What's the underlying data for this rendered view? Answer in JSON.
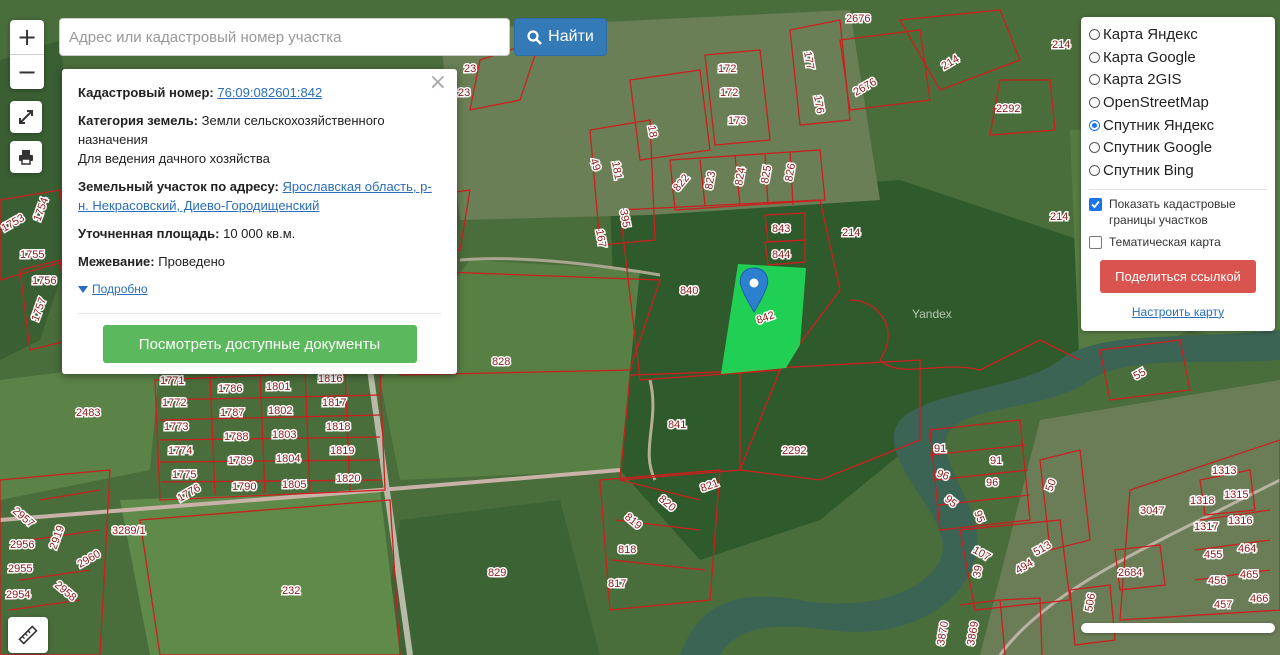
{
  "colors": {
    "satellite_base": "#4a6d3c",
    "forest": "#2f5a2b",
    "river": "#3f6a56",
    "boundary": "#cc1f1f",
    "selected_parcel": "#1ee05a",
    "marker": "#2d7fd0",
    "search_button": "#337ab7",
    "docs_button": "#5cb85c",
    "share_button": "#d9534f"
  },
  "map": {
    "zoom_in": "+",
    "zoom_out": "−",
    "fullscreen_icon": "expand-icon",
    "print_icon": "printer-icon",
    "ruler_icon": "ruler-icon",
    "watermark": "Yandex",
    "parcel_labels": [
      "2676",
      "214",
      "214",
      "2676",
      "2292",
      "177",
      "176",
      "172",
      "172",
      "173",
      "18",
      "49",
      "181",
      "395",
      "167",
      "822",
      "823",
      "824",
      "825",
      "826",
      "843",
      "844",
      "840",
      "842",
      "828",
      "841",
      "2292",
      "214",
      "214",
      "55",
      "820",
      "821",
      "819",
      "818",
      "817",
      "829",
      "232",
      "1771",
      "1786",
      "1801",
      "1816",
      "1772",
      "1787",
      "1802",
      "1817",
      "1773",
      "1788",
      "1803",
      "1818",
      "1774",
      "1789",
      "1804",
      "1819",
      "1775",
      "1790",
      "1805",
      "1820",
      "1776",
      "2483",
      "1755",
      "1756",
      "1754",
      "1753",
      "1757",
      "3289/1",
      "2957",
      "2956",
      "2919",
      "2960",
      "2955",
      "2958",
      "2954",
      "91",
      "91",
      "96",
      "96",
      "95",
      "95",
      "50",
      "107",
      "513",
      "494",
      "3047",
      "1313",
      "1318",
      "1315",
      "1317",
      "1316",
      "455",
      "464",
      "456",
      "465",
      "457",
      "466",
      "2684",
      "3870",
      "3869",
      "506",
      "39",
      "23",
      "23"
    ]
  },
  "search": {
    "placeholder": "Адрес или кадастровый номер участка",
    "value": "",
    "button_label": "Найти",
    "button_icon": "search-icon"
  },
  "popup": {
    "cadastral_label": "Кадастровый номер:",
    "cadastral_value": "76:09:082601:842",
    "category_label": "Категория земель:",
    "category_value": "Земли сельскохозяйственного назначения",
    "usage_value": "Для ведения дачного хозяйства",
    "address_label": "Земельный участок по адресу:",
    "address_value": "Ярославская область, р-н. Некрасовский, Диево-Городищенский",
    "area_label": "Уточненная площадь:",
    "area_value": "10 000 кв.м.",
    "survey_label": "Межевание:",
    "survey_value": "Проведено",
    "details_label": "Подробно",
    "docs_button": "Посмотреть доступные документы",
    "close_glyph": "×"
  },
  "layers": {
    "options": [
      {
        "label": "Карта Яндекс",
        "selected": false
      },
      {
        "label": "Карта Google",
        "selected": false
      },
      {
        "label": "Карта 2GIS",
        "selected": false
      },
      {
        "label": "OpenStreetMap",
        "selected": false
      },
      {
        "label": "Спутник Яндекс",
        "selected": true
      },
      {
        "label": "Спутник Google",
        "selected": false
      },
      {
        "label": "Спутник Bing",
        "selected": false
      }
    ],
    "show_boundaries_label": "Показать кадастровые границы участков",
    "show_boundaries_checked": true,
    "thematic_label": "Тематическая карта",
    "thematic_checked": false,
    "share_button": "Поделиться ссылкой",
    "settings_link": "Настроить карту"
  }
}
